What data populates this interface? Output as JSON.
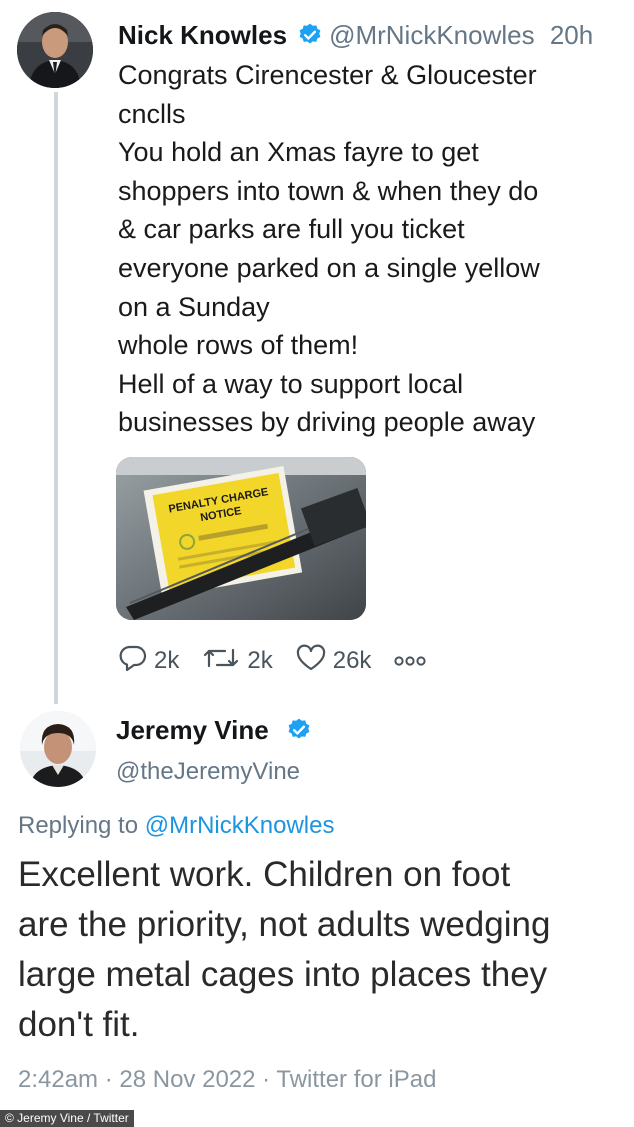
{
  "tweet1": {
    "author_name": "Nick Knowles",
    "author_handle": "@MrNickKnowles",
    "time": "20h",
    "text_lines": [
      "Congrats Cirencester & Gloucester",
      "cnclls",
      "You hold an Xmas fayre to get",
      "shoppers into town & when they do",
      "& car parks are full you ticket",
      "everyone parked on a single yellow",
      "on a Sunday",
      "whole rows of them!",
      "Hell of a way to support local",
      "businesses by driving people away"
    ],
    "image": {
      "ticket_line1": "PENALTY CHARGE",
      "ticket_line2": "NOTICE"
    },
    "actions": {
      "replies": "2k",
      "retweets": "2k",
      "likes": "26k"
    }
  },
  "tweet2": {
    "author_name": "Jeremy Vine",
    "author_handle": "@theJeremyVine",
    "replying_prefix": "Replying to",
    "replying_handle": "@MrNickKnowles",
    "text_lines": [
      "Excellent work. Children on foot",
      "are the priority, not adults wedging",
      "large metal cages into places they",
      "don't fit."
    ],
    "meta": "2:42am · 28 Nov 2022 · Twitter for iPad"
  },
  "credit": "© Jeremy Vine / Twitter",
  "colors": {
    "verified": "#1da1f2",
    "mention": "#1b95e0",
    "secondary_text": "#657786",
    "thread_line": "#cfd6dc"
  }
}
